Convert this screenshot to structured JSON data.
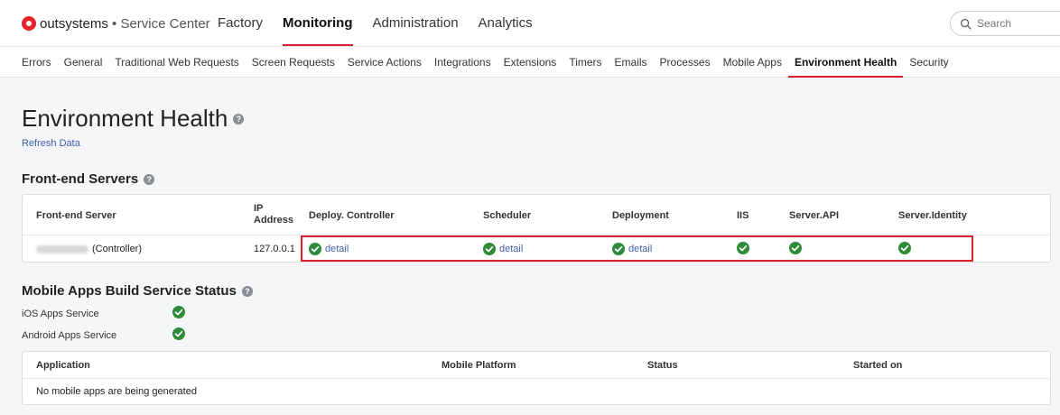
{
  "brand": {
    "name": "outsystems",
    "separator": " • ",
    "product": "Service Center"
  },
  "main_nav": [
    {
      "label": "Factory",
      "active": false
    },
    {
      "label": "Monitoring",
      "active": true
    },
    {
      "label": "Administration",
      "active": false
    },
    {
      "label": "Analytics",
      "active": false
    }
  ],
  "search": {
    "placeholder": "Search",
    "value": ""
  },
  "sub_nav": [
    {
      "label": "Errors"
    },
    {
      "label": "General"
    },
    {
      "label": "Traditional Web Requests"
    },
    {
      "label": "Screen Requests"
    },
    {
      "label": "Service Actions"
    },
    {
      "label": "Integrations"
    },
    {
      "label": "Extensions"
    },
    {
      "label": "Timers"
    },
    {
      "label": "Emails"
    },
    {
      "label": "Processes"
    },
    {
      "label": "Mobile Apps"
    },
    {
      "label": "Environment Health",
      "active": true
    },
    {
      "label": "Security"
    }
  ],
  "page": {
    "title": "Environment Health",
    "help": "?",
    "refresh_label": "Refresh Data"
  },
  "frontend": {
    "title": "Front-end Servers",
    "help": "?",
    "columns": {
      "server": "Front-end Server",
      "ip_line1": "IP",
      "ip_line2": "Address",
      "deploy_controller": "Deploy. Controller",
      "scheduler": "Scheduler",
      "deployment": "Deployment",
      "iis": "IIS",
      "server_api": "Server.API",
      "server_identity": "Server.Identity"
    },
    "row": {
      "server_suffix": "(Controller)",
      "ip": "127.0.0.1",
      "detail_label": "detail"
    },
    "status_color": "#2e8b3a",
    "highlight_color": "#d9222a"
  },
  "mobile": {
    "title": "Mobile Apps Build Service Status",
    "help": "?",
    "services": [
      {
        "label": "iOS Apps Service",
        "status": "ok"
      },
      {
        "label": "Android Apps Service",
        "status": "ok"
      }
    ],
    "columns": {
      "application": "Application",
      "platform": "Mobile Platform",
      "status": "Status",
      "started": "Started on"
    },
    "empty_message": "No mobile apps are being generated"
  },
  "colors": {
    "accent": "#d4202a",
    "link": "#3d5fa8",
    "ok": "#2e8b3a"
  }
}
